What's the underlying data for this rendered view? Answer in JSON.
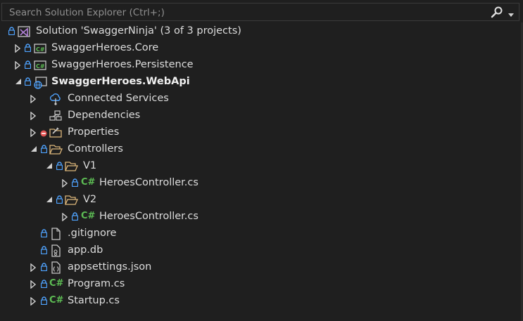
{
  "search": {
    "placeholder": "Search Solution Explorer (Ctrl+;)"
  },
  "tree": [
    {
      "label": "Solution 'SwaggerNinja' (3 of 3 projects)",
      "icon": "solution-icon",
      "expander": "none"
    },
    {
      "label": "SwaggerHeroes.Core",
      "icon": "csharp-project-icon",
      "expander": "collapsed"
    },
    {
      "label": "SwaggerHeroes.Persistence",
      "icon": "csharp-project-icon",
      "expander": "collapsed"
    },
    {
      "label": "SwaggerHeroes.WebApi",
      "icon": "web-project-icon",
      "expander": "expanded"
    },
    {
      "label": "Connected Services",
      "icon": "connected-services-icon",
      "expander": "collapsed"
    },
    {
      "label": "Dependencies",
      "icon": "dependencies-icon",
      "expander": "collapsed"
    },
    {
      "label": "Properties",
      "icon": "properties-icon",
      "expander": "collapsed"
    },
    {
      "label": "Controllers",
      "icon": "folder-open-icon",
      "expander": "expanded"
    },
    {
      "label": "V1",
      "icon": "folder-open-icon",
      "expander": "expanded"
    },
    {
      "label": "HeroesController.cs",
      "icon": "csharp-file-icon",
      "expander": "collapsed"
    },
    {
      "label": "V2",
      "icon": "folder-open-icon",
      "expander": "expanded"
    },
    {
      "label": "HeroesController.cs",
      "icon": "csharp-file-icon",
      "expander": "collapsed"
    },
    {
      "label": ".gitignore",
      "icon": "file-icon",
      "expander": "none"
    },
    {
      "label": "app.db",
      "icon": "database-file-icon",
      "expander": "none"
    },
    {
      "label": "appsettings.json",
      "icon": "json-file-icon",
      "expander": "collapsed"
    },
    {
      "label": "Program.cs",
      "icon": "csharp-file-icon",
      "expander": "collapsed"
    },
    {
      "label": "Startup.cs",
      "icon": "csharp-file-icon",
      "expander": "collapsed"
    }
  ],
  "colors": {
    "background": "#1f1f1f",
    "lock": "#4fa3ff",
    "csharp": "#5dbd54",
    "folder": "#dcb67a",
    "text": "#dcdcdc"
  }
}
